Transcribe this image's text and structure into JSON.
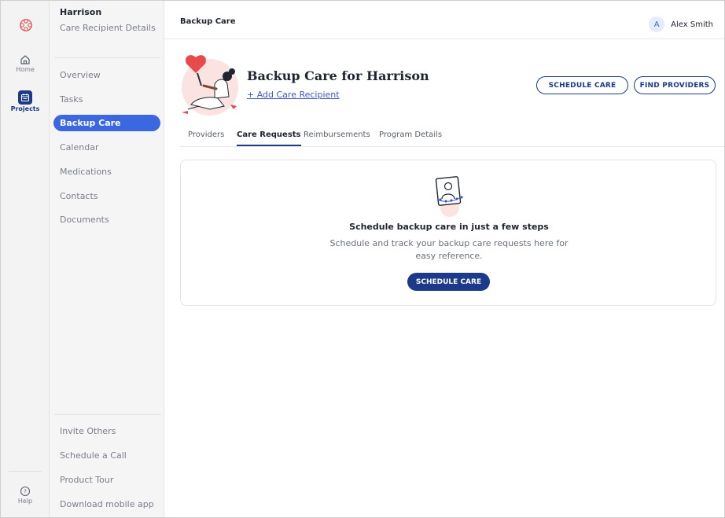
{
  "rail": {
    "home_label": "Home",
    "projects_label": "Projects",
    "help_label": "Help"
  },
  "sidebar": {
    "title": "Harrison",
    "subtitle": "Care Recipient Details",
    "items": [
      {
        "label": "Overview"
      },
      {
        "label": "Tasks"
      },
      {
        "label": "Backup Care"
      },
      {
        "label": "Calendar"
      },
      {
        "label": "Medications"
      },
      {
        "label": "Contacts"
      },
      {
        "label": "Documents"
      }
    ],
    "footer": [
      {
        "label": "Invite Others"
      },
      {
        "label": "Schedule a Call"
      },
      {
        "label": "Product Tour"
      },
      {
        "label": "Download mobile app"
      }
    ]
  },
  "header": {
    "title": "Backup Care",
    "user_initial": "A",
    "user_name": "Alex Smith"
  },
  "hero": {
    "title": "Backup Care for Harrison",
    "add_link": "+ Add Care Recipient",
    "schedule_button": "SCHEDULE CARE",
    "find_button": "FIND PROVIDERS"
  },
  "tabs": [
    {
      "label": "Providers"
    },
    {
      "label": "Care Requests"
    },
    {
      "label": "Reimbursements"
    },
    {
      "label": "Program Details"
    }
  ],
  "empty_state": {
    "title": "Schedule backup care in just a few steps",
    "description": "Schedule and track your backup care requests here for easy reference.",
    "button": "SCHEDULE CARE"
  },
  "colors": {
    "accent": "#3b67e0",
    "brand_dark": "#1d3a8a",
    "logo": "#d9534f"
  },
  "icons": {
    "logo": "care-logo-icon",
    "home": "home-icon",
    "projects": "calendar-icon",
    "help": "help-circle-icon",
    "empty_state": "profile-hearts-icon"
  }
}
